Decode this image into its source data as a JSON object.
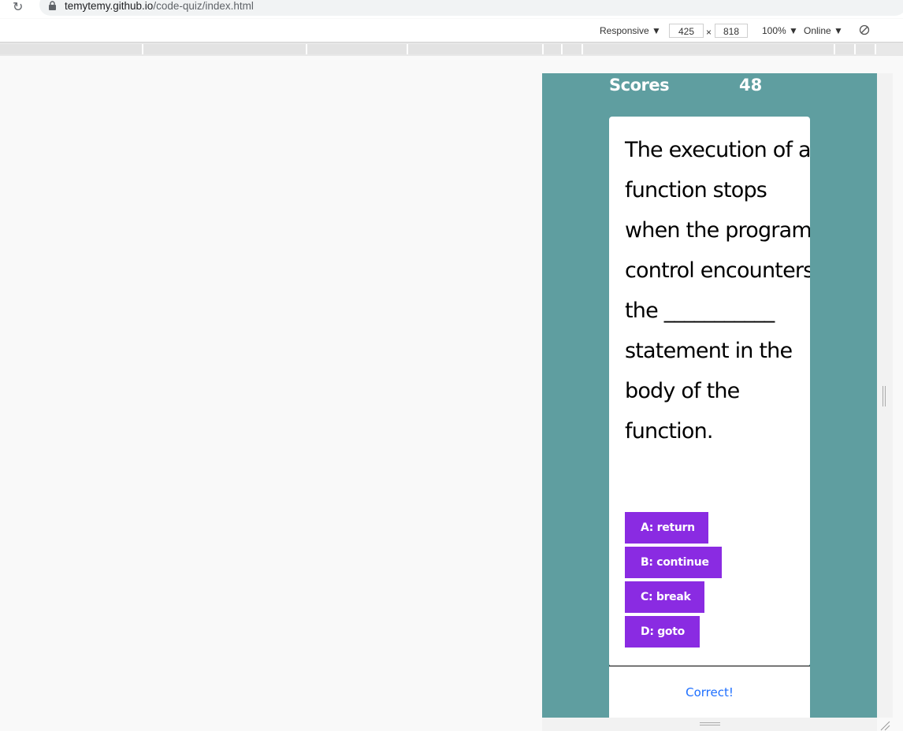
{
  "browser": {
    "url_host": "temytemy.github.io",
    "url_path": "/code-quiz/index.html"
  },
  "device_toolbar": {
    "device": "Responsive",
    "width": "425",
    "times": "×",
    "height": "818",
    "zoom": "100%",
    "network": "Online"
  },
  "quiz": {
    "scores_label": "Scores",
    "scores_value": "48",
    "question": "The execution of a function stops when the program control encounters the ___________ statement in the body of the function.",
    "answers": [
      {
        "label": "A:  return"
      },
      {
        "label": "B:  continue"
      },
      {
        "label": "C:  break"
      },
      {
        "label": "D:  goto"
      }
    ],
    "answer_color": "#8a2be2",
    "background_color": "#5f9ea0",
    "feedback": "Correct!"
  }
}
